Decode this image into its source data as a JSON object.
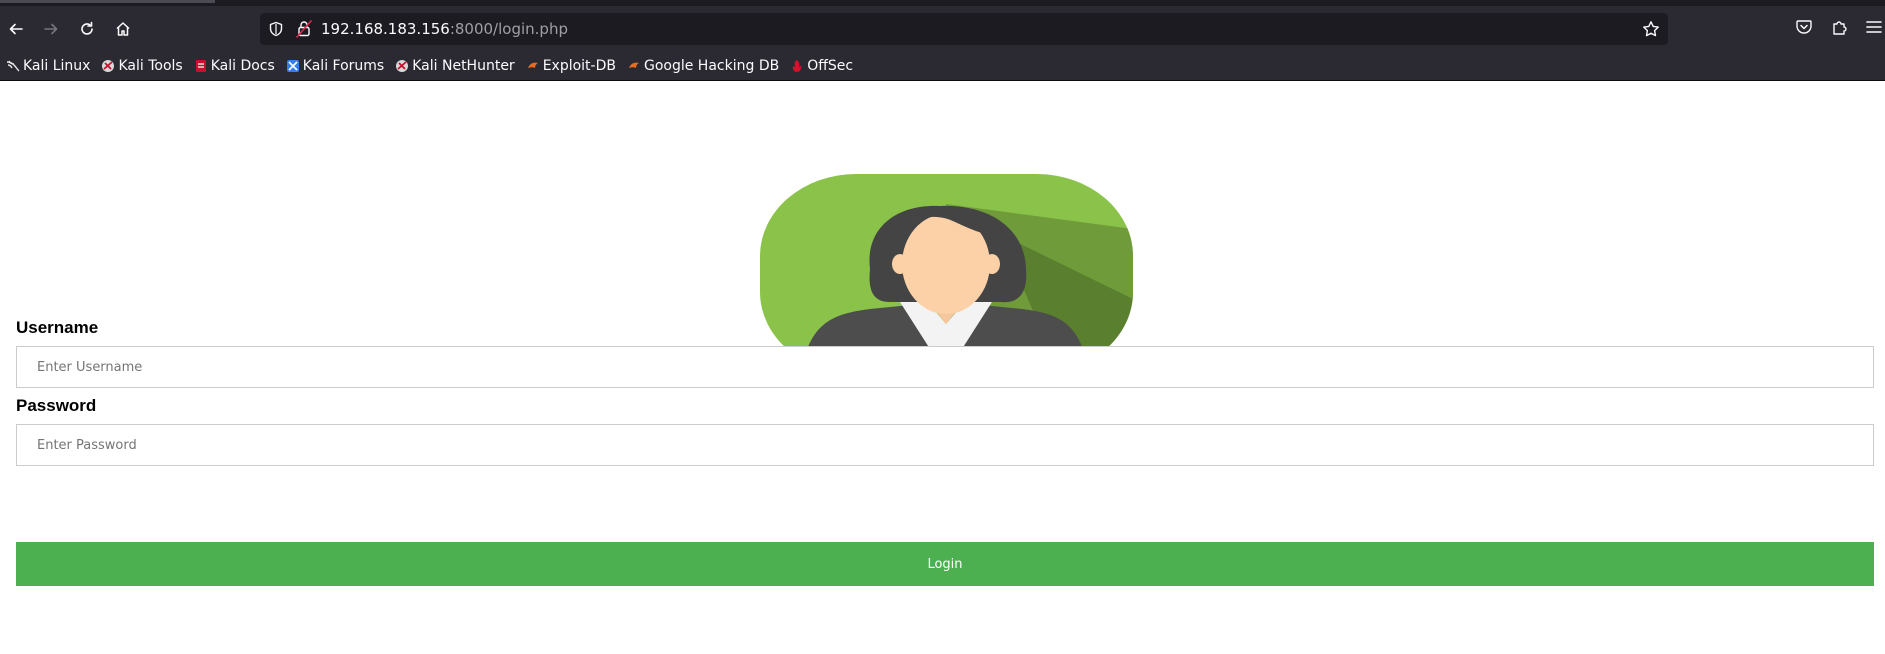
{
  "browser": {
    "url_host": "192.168.183.156",
    "url_rest": ":8000/login.php",
    "bookmarks": [
      {
        "label": "Kali Linux",
        "icon": "kali-dragon-icon"
      },
      {
        "label": "Kali Tools",
        "icon": "kali-tools-icon"
      },
      {
        "label": "Kali Docs",
        "icon": "kali-docs-icon"
      },
      {
        "label": "Kali Forums",
        "icon": "kali-forums-icon"
      },
      {
        "label": "Kali NetHunter",
        "icon": "kali-nethunter-icon"
      },
      {
        "label": "Exploit-DB",
        "icon": "exploit-db-icon"
      },
      {
        "label": "Google Hacking DB",
        "icon": "ghdb-icon"
      },
      {
        "label": "OffSec",
        "icon": "offsec-icon"
      }
    ]
  },
  "login_form": {
    "username_label": "Username",
    "username_placeholder": "Enter Username",
    "password_label": "Password",
    "password_placeholder": "Enter Password",
    "login_label": "Login",
    "button_color": "#4caf50"
  },
  "avatar": {
    "icon": "female-user-avatar-icon",
    "bg_color": "#8bc34a"
  }
}
